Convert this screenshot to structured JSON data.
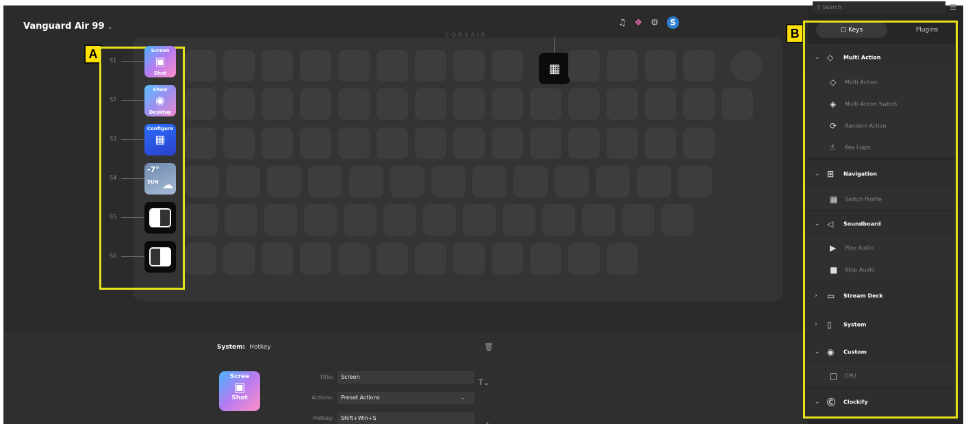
{
  "header": {
    "device_name": "Vanguard Air 99",
    "device_chevron": "⌄",
    "brand": "CORSAIR",
    "icons": [
      "bell-icon",
      "puzzle-icon",
      "gear-icon",
      "user-avatar"
    ],
    "avatar_letter": "S"
  },
  "callouts": {
    "a": "A",
    "b": "B"
  },
  "side_keys": [
    {
      "label": "S1",
      "tile_top": "Screen",
      "tile_bottom": "Shot",
      "style": "grad1",
      "icon": "screenshot-icon"
    },
    {
      "label": "S2",
      "tile_top": "Show",
      "tile_bottom": "Desktop",
      "style": "grad2",
      "icon": "desktop-icon"
    },
    {
      "label": "S3",
      "tile_top": "Configure",
      "tile_bottom": "",
      "style": "blue",
      "icon": "keypad-icon"
    },
    {
      "label": "S4",
      "tile_top": "-7°",
      "tile_bottom": "SUN",
      "style": "weather",
      "icon": "cloud-icon"
    },
    {
      "label": "S5",
      "tile_top": "",
      "tile_bottom": "",
      "style": "toggle",
      "icon": "toggle-left-icon"
    },
    {
      "label": "S6",
      "tile_top": "",
      "tile_bottom": "",
      "style": "toggle",
      "icon": "toggle-right-icon"
    }
  ],
  "properties": {
    "category": "System:",
    "action": "Hotkey",
    "tile_top": "Scree",
    "tile_bottom": "Shot",
    "title_label": "Title:",
    "title_value": "Screen",
    "actions_label": "Actions:",
    "actions_value": "Preset Actions",
    "hotkey_label": "Hotkey:",
    "hotkey_value": "Shift+Win+S",
    "text_size_glyph": "T⌄"
  },
  "sidebar": {
    "search_placeholder": "Search",
    "tabs": [
      {
        "label": "Keys",
        "active": true
      },
      {
        "label": "Plugins",
        "active": false
      }
    ],
    "items": [
      {
        "type": "cat",
        "label": "Multi Action",
        "chev": "⌄",
        "icon": "multi-action-icon",
        "glyph": "◇"
      },
      {
        "type": "sub",
        "label": "Multi Action",
        "icon": "multi-action-icon",
        "glyph": "◇"
      },
      {
        "type": "sub",
        "label": "Multi Action Switch",
        "icon": "switch-icon",
        "glyph": "◈"
      },
      {
        "type": "sub",
        "label": "Random Action",
        "icon": "random-icon",
        "glyph": "⟳"
      },
      {
        "type": "sub",
        "label": "Key Logic",
        "icon": "key-logic-icon",
        "glyph": "☝"
      },
      {
        "type": "cat",
        "label": "Navigation",
        "chev": "⌄",
        "icon": "navigation-icon",
        "glyph": "⊞"
      },
      {
        "type": "sub",
        "label": "Switch Profile",
        "icon": "profile-icon",
        "glyph": "▦"
      },
      {
        "type": "cat",
        "label": "Soundboard",
        "chev": "⌄",
        "icon": "soundboard-icon",
        "glyph": "◁"
      },
      {
        "type": "sub",
        "label": "Play Audio",
        "icon": "play-audio-icon",
        "glyph": "▶"
      },
      {
        "type": "sub",
        "label": "Stop Audio",
        "icon": "stop-audio-icon",
        "glyph": "■"
      },
      {
        "type": "cat",
        "label": "Stream Deck",
        "chev": "›",
        "icon": "stream-deck-icon",
        "glyph": "▭"
      },
      {
        "type": "cat",
        "label": "System",
        "chev": "›",
        "icon": "system-icon",
        "glyph": "▯"
      },
      {
        "type": "cat",
        "label": "Custom",
        "chev": "⌄",
        "icon": "custom-icon",
        "glyph": "◉"
      },
      {
        "type": "sub",
        "label": "CPU",
        "icon": "cpu-icon",
        "glyph": "□"
      },
      {
        "type": "cat",
        "label": "Clockify",
        "chev": "⌄",
        "icon": "clockify-icon",
        "glyph": "Ⓒ"
      }
    ]
  }
}
